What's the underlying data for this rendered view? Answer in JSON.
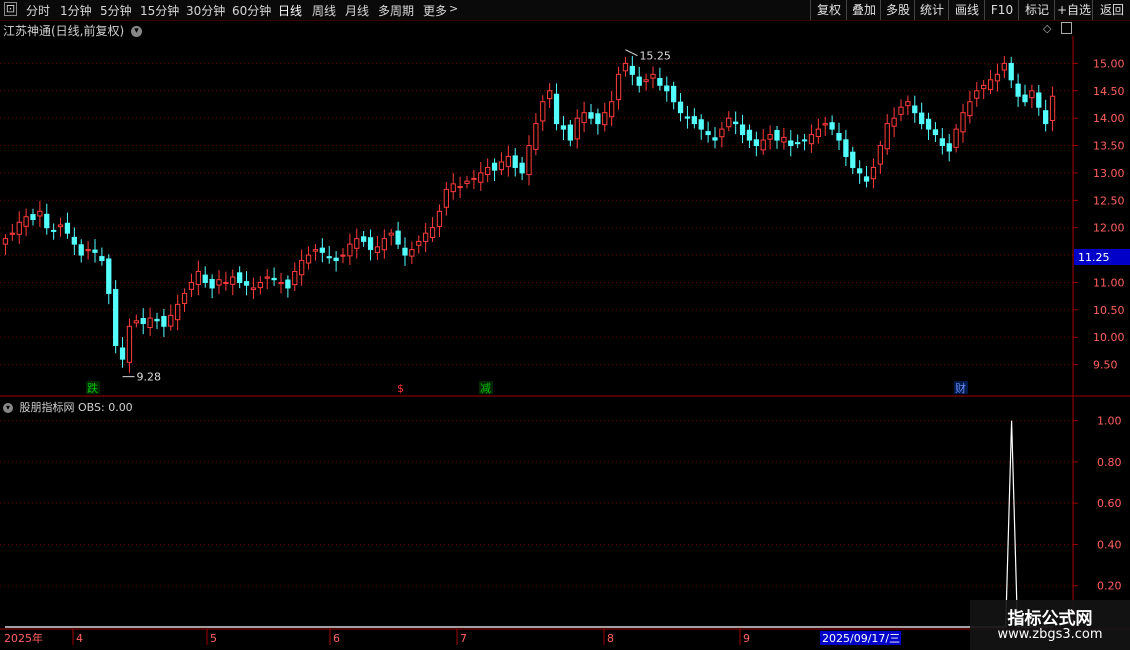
{
  "toolbar": {
    "periods": [
      "分时",
      "1分钟",
      "5分钟",
      "15分钟",
      "30分钟",
      "60分钟",
      "日线",
      "周线",
      "月线",
      "多周期",
      "更多"
    ],
    "active_period": "日线",
    "right_buttons": [
      "复权",
      "叠加",
      "多股",
      "统计",
      "画线",
      "F10",
      "标记",
      "+自选",
      "返回"
    ]
  },
  "chart": {
    "title": "江苏神通(日线,前复权)",
    "high_label": "15.25",
    "low_label": "9.28",
    "price_tag": "11.25",
    "markers": [
      {
        "label": "跌",
        "color": "#00c000"
      },
      {
        "label": "$",
        "color": "#ff3030"
      },
      {
        "label": "减",
        "color": "#00c000"
      },
      {
        "label": "财",
        "color": "#4a6cff"
      }
    ],
    "y_ticks": [
      "15.00",
      "14.50",
      "14.00",
      "13.50",
      "13.00",
      "12.50",
      "12.00",
      "11.50",
      "11.00",
      "10.50",
      "10.00",
      "9.50"
    ],
    "colors": {
      "up": "#ff3c3c",
      "down": "#54ffff",
      "axis": "#a00000",
      "grid": "#6a0000"
    }
  },
  "indicator": {
    "title": "股朋指标网 OBS: 0.00",
    "y_ticks": [
      "1.00",
      "0.80",
      "0.60",
      "0.40",
      "0.20"
    ]
  },
  "x_axis": {
    "labels": [
      "2025年",
      "4",
      "5",
      "6",
      "7",
      "8",
      "9"
    ],
    "cursor_date": "2025/09/17/三"
  },
  "watermark": {
    "line1": "指标公式网",
    "line2": "www.zbgs3.com"
  },
  "chart_data": {
    "type": "candlestick",
    "series": [
      {
        "values": [
          11.8,
          11.9,
          12.1,
          12.2,
          12.15,
          12.3,
          12.0,
          11.95,
          12.05,
          11.9,
          11.7,
          11.5,
          11.6,
          11.55,
          11.4,
          10.8,
          9.85,
          9.6,
          10.2,
          10.3,
          10.25,
          10.35,
          10.3,
          10.2,
          10.4,
          10.6,
          10.8,
          11.0,
          11.2,
          11.0,
          10.9,
          11.05,
          11.0,
          11.1,
          11.0,
          10.95,
          10.9,
          11.0,
          11.1,
          11.05,
          11.0,
          10.9,
          11.2,
          11.4,
          11.5,
          11.6,
          11.55,
          11.45,
          11.4,
          11.5,
          11.7,
          11.8,
          11.75,
          11.6,
          11.65,
          11.8,
          11.9,
          11.7,
          11.5,
          11.6,
          11.75,
          11.9,
          12.0,
          12.3,
          12.7,
          12.8,
          12.75,
          12.85,
          12.9,
          13.0,
          13.1,
          13.05,
          13.2,
          13.3,
          13.1,
          13.0,
          13.5,
          13.9,
          14.3,
          14.5,
          13.9,
          13.8,
          13.6,
          14.0,
          14.1,
          14.0,
          13.9,
          14.1,
          14.3,
          14.8,
          15.0,
          14.8,
          14.6,
          14.7,
          14.8,
          14.6,
          14.5,
          14.3,
          14.1,
          14.0,
          13.9,
          13.8,
          13.7,
          13.6,
          13.8,
          14.0,
          13.9,
          13.7,
          13.6,
          13.5,
          13.6,
          13.7,
          13.6,
          13.65,
          13.5,
          13.55,
          13.6,
          13.7,
          13.8,
          13.9,
          13.8,
          13.6,
          13.3,
          13.1,
          13.0,
          12.85,
          13.1,
          13.5,
          13.9,
          14.0,
          14.2,
          14.3,
          14.1,
          13.9,
          13.8,
          13.7,
          13.5,
          13.4,
          13.8,
          14.1,
          14.3,
          14.5,
          14.6,
          14.7,
          14.8,
          15.0,
          14.7,
          14.4,
          14.3,
          14.5,
          14.2,
          13.9,
          14.4
        ]
      }
    ],
    "ylim": [
      9.0,
      15.5
    ],
    "high": 15.25,
    "low": 9.28,
    "indicator_series": [
      {
        "name": "OBS",
        "values": [
          0,
          0,
          0,
          0,
          0,
          0,
          0,
          0,
          0,
          0,
          0,
          0,
          0,
          0,
          0,
          0,
          0,
          0,
          0,
          0,
          0,
          0,
          0,
          0,
          0,
          0,
          0,
          0,
          0,
          0,
          0,
          0,
          0,
          0,
          0,
          0,
          0,
          0,
          0,
          0,
          0,
          0,
          0,
          0,
          0,
          0,
          0,
          0,
          0,
          0,
          0,
          0,
          0,
          0,
          0,
          0,
          0,
          0,
          0,
          0,
          0,
          0,
          0,
          0,
          0,
          0,
          0,
          0,
          0,
          0,
          0,
          0,
          0,
          0,
          0,
          0,
          0,
          0,
          0,
          0,
          0,
          0,
          0,
          0,
          0,
          0,
          0,
          0,
          0,
          0,
          0,
          0,
          0,
          0,
          0,
          0,
          0,
          0,
          0,
          0,
          0,
          0,
          0,
          0,
          0,
          0,
          0,
          0,
          0,
          0,
          0,
          0,
          0,
          0,
          0,
          0,
          0,
          0,
          0,
          0,
          0,
          0,
          0,
          0,
          0,
          0,
          0,
          0,
          0,
          0,
          0,
          0,
          0,
          0,
          0,
          0,
          0,
          0,
          0,
          0,
          0,
          0,
          0,
          0,
          0,
          0,
          0,
          0,
          0,
          0,
          0,
          0,
          0,
          0,
          0,
          0,
          0,
          0,
          0,
          0,
          0,
          0,
          0,
          0,
          0,
          0,
          0,
          0,
          0,
          0,
          1.0,
          0,
          0,
          0,
          0,
          0,
          0,
          0
        ]
      }
    ],
    "indicator_ylim": [
      0,
      1.1
    ]
  }
}
